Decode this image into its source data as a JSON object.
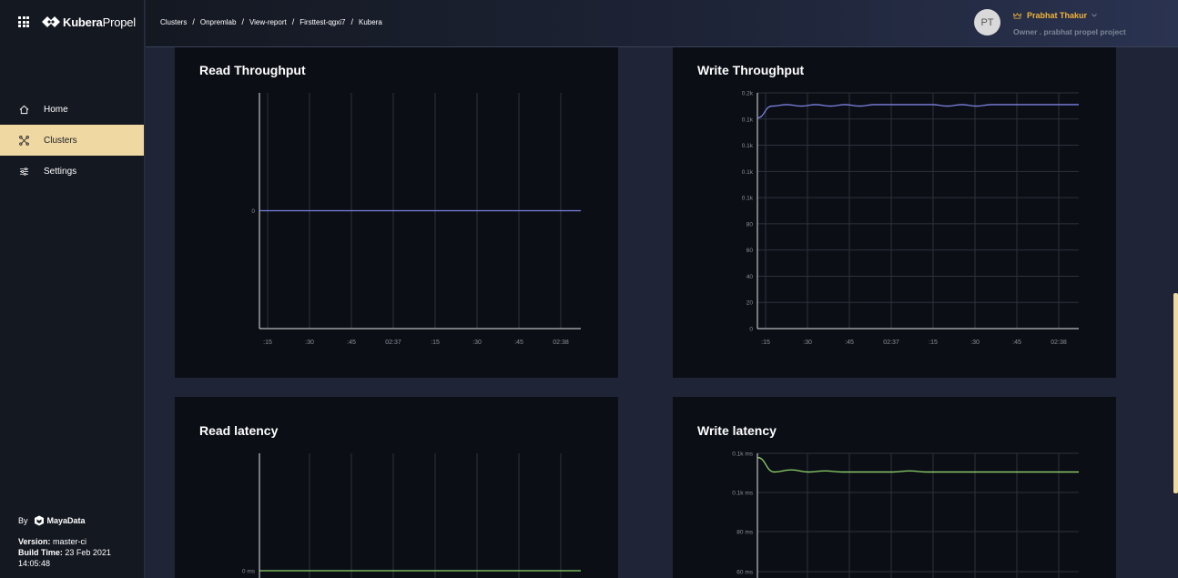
{
  "brand": {
    "name_bold": "Kubera",
    "name_light": "Propel"
  },
  "nav": {
    "items": [
      {
        "label": "Home",
        "icon": "home-icon"
      },
      {
        "label": "Clusters",
        "icon": "clusters-icon",
        "active": true
      },
      {
        "label": "Settings",
        "icon": "settings-icon"
      }
    ]
  },
  "footer": {
    "by": "By",
    "company": "MayaData",
    "version_label": "Version:",
    "version_value": "master-ci",
    "build_label": "Build Time:",
    "build_value": "23 Feb 2021 14:05:48"
  },
  "breadcrumb": [
    "Clusters",
    "Onpremlab",
    "View-report",
    "Firsttest-qgxi7",
    "Kubera"
  ],
  "user": {
    "initials": "PT",
    "name": "Prabhat Thakur",
    "role": "Owner . prabhat propel project"
  },
  "colors": {
    "accent": "#efd8a1",
    "user": "#f2b43a",
    "throughput": "#7b82e0",
    "latency": "#8fd46a"
  },
  "chart_data": [
    {
      "type": "line",
      "title": "Read Throughput",
      "x": [
        ":15",
        ":30",
        ":45",
        "02:37",
        ":15",
        ":30",
        ":45",
        "02:38"
      ],
      "y_ticks": [
        "0"
      ],
      "series": [
        {
          "values": [
            0,
            0,
            0,
            0,
            0,
            0,
            0,
            0,
            0,
            0
          ]
        }
      ]
    },
    {
      "type": "line",
      "title": "Write Throughput",
      "x": [
        ":15",
        ":30",
        ":45",
        "02:37",
        ":15",
        ":30",
        ":45",
        "02:38"
      ],
      "y_ticks": [
        "0",
        "20",
        "40",
        "60",
        "80",
        "0.1k",
        "0.1k",
        "0.1k",
        "0.1k",
        "0.2k"
      ],
      "ylim": [
        0,
        160
      ],
      "series": [
        {
          "values": [
            143,
            151,
            152,
            151,
            152,
            151,
            152,
            151,
            152,
            152,
            152,
            152,
            152,
            151,
            152,
            151,
            152,
            152,
            152,
            152,
            152,
            152,
            152
          ]
        }
      ]
    },
    {
      "type": "line",
      "title": "Read latency",
      "x": [],
      "y_ticks": [
        "0 ms"
      ],
      "series": [
        {
          "values": [
            0,
            0,
            0,
            0,
            0,
            0,
            0,
            0,
            0,
            0
          ]
        }
      ]
    },
    {
      "type": "line",
      "title": "Write latency",
      "x": [],
      "y_ticks": [
        "60 ms",
        "80 ms",
        "0.1k ms",
        "0.1k ms"
      ],
      "ylim": [
        60,
        120
      ],
      "series": [
        {
          "values": [
            118,
            111,
            112,
            111,
            111.5,
            111,
            111,
            111,
            111,
            111.5,
            111,
            111,
            111,
            111,
            111,
            111,
            111,
            111,
            111,
            111
          ]
        }
      ]
    }
  ]
}
